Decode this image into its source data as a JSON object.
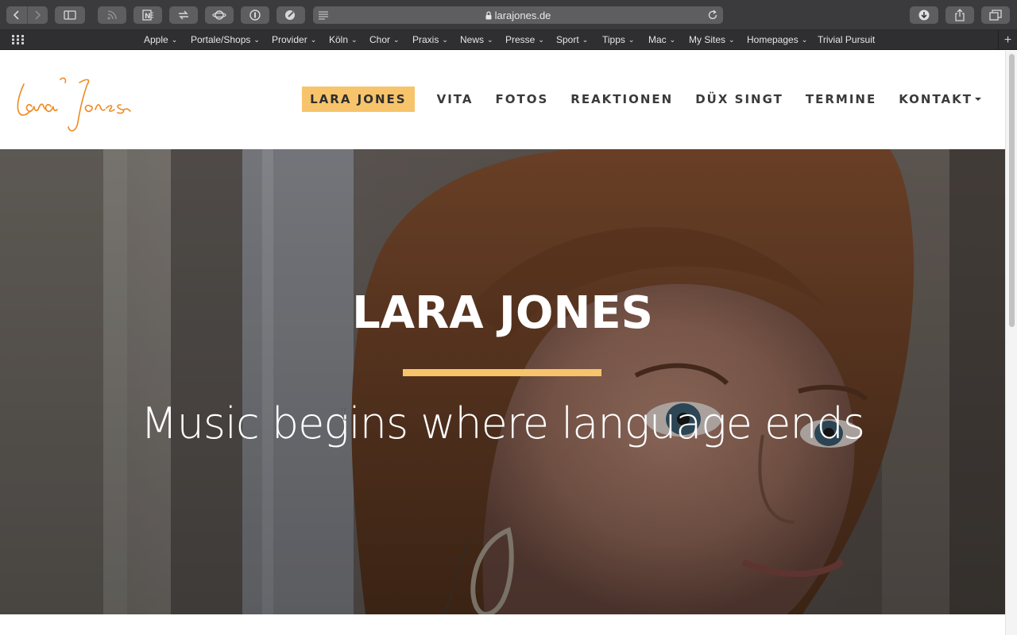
{
  "browser": {
    "url": "larajones.de",
    "toolbar_icons": [
      "back-icon",
      "forward-icon",
      "sidebar-icon",
      "rss-icon",
      "onenote-icon",
      "transfer-icon",
      "sync-icon",
      "password-icon",
      "extension-icon",
      "reader-icon",
      "reload-icon",
      "download-icon",
      "share-icon",
      "tabs-icon"
    ]
  },
  "bookmarks": {
    "items": [
      "Apple",
      "Portale/Shops",
      "Provider",
      "Köln",
      "Chor",
      "Praxis",
      "News",
      "Presse",
      "Sport",
      "Tipps",
      "Mac",
      "My Sites",
      "Homepages"
    ],
    "trivial": "Trivial Pursuit"
  },
  "site": {
    "logo_text": "Lara Jones",
    "nav": [
      "LARA JONES",
      "VITA",
      "FOTOS",
      "REAKTIONEN",
      "DÜX SINGT",
      "TERMINE",
      "KONTAKT"
    ],
    "active_nav": "LARA JONES",
    "accent": "#f7c46c"
  },
  "hero": {
    "title": "LARA JONES",
    "subtitle": "Music begins where language ends"
  }
}
